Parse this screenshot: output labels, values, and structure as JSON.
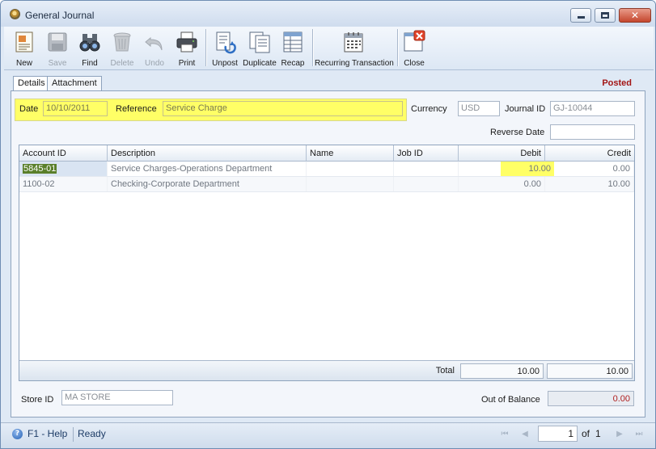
{
  "window": {
    "title": "General Journal"
  },
  "toolbar": {
    "buttons": [
      {
        "label": "New",
        "icon": "new-document-icon",
        "enabled": true
      },
      {
        "label": "Save",
        "icon": "floppy-disk-icon",
        "enabled": false
      },
      {
        "label": "Find",
        "icon": "binoculars-icon",
        "enabled": true
      },
      {
        "label": "Delete",
        "icon": "trash-can-icon",
        "enabled": false
      },
      {
        "label": "Undo",
        "icon": "undo-arrow-icon",
        "enabled": false
      },
      {
        "label": "Print",
        "icon": "printer-icon",
        "enabled": true
      },
      {
        "label": "Unpost",
        "icon": "unpost-icon",
        "enabled": true
      },
      {
        "label": "Duplicate",
        "icon": "duplicate-icon",
        "enabled": true
      },
      {
        "label": "Recap",
        "icon": "recap-icon",
        "enabled": true
      },
      {
        "label": "Recurring Transaction",
        "icon": "recurring-calendar-icon",
        "enabled": true
      },
      {
        "label": "Close",
        "icon": "close-form-icon",
        "enabled": true
      }
    ]
  },
  "tabs": [
    {
      "label": "Details",
      "active": true
    },
    {
      "label": "Attachment",
      "active": false
    }
  ],
  "status": "Posted",
  "header": {
    "date_label": "Date",
    "date_value": "10/10/2011",
    "reference_label": "Reference",
    "reference_value": "Service Charge",
    "currency_label": "Currency",
    "currency_value": "USD",
    "journal_id_label": "Journal ID",
    "journal_id_value": "GJ-10044",
    "reverse_date_label": "Reverse Date",
    "reverse_date_value": ""
  },
  "grid": {
    "columns": [
      "Account ID",
      "Description",
      "Name",
      "Job ID",
      "Debit",
      "Credit"
    ],
    "rows": [
      {
        "account_id": "5845-01",
        "description": "Service Charges-Operations Department",
        "name": "",
        "job_id": "",
        "debit": "10.00",
        "credit": "0.00"
      },
      {
        "account_id": "1100-02",
        "description": "Checking-Corporate Department",
        "name": "",
        "job_id": "",
        "debit": "0.00",
        "credit": "10.00"
      }
    ],
    "total_label": "Total",
    "total_debit": "10.00",
    "total_credit": "10.00"
  },
  "footer": {
    "store_id_label": "Store ID",
    "store_id_value": "MA STORE",
    "out_of_balance_label": "Out of Balance",
    "out_of_balance_value": "0.00"
  },
  "statusbar": {
    "help": "F1 - Help",
    "state": "Ready",
    "page_current": "1",
    "page_of": "of",
    "page_total": "1"
  },
  "colors": {
    "highlight": "#ffff66",
    "posted": "#a31515",
    "out_of_balance": "#b02020"
  }
}
